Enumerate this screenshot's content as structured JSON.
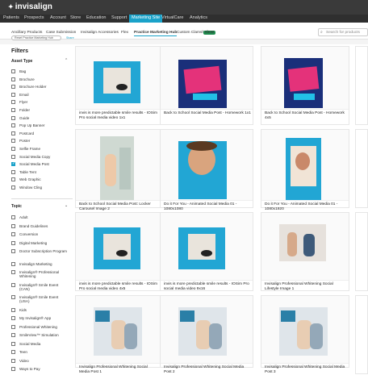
{
  "header": {
    "logo": "invisalign",
    "nav": [
      "Patients",
      "Prospects",
      "Account",
      "Store",
      "Education",
      "Support",
      "Marketing Site",
      "VirtualCare",
      "Analytics"
    ],
    "active_nav": "Marketing Site"
  },
  "subnav": {
    "items": [
      "Ancillary Products",
      "Case Submission",
      "Invisalign Accessories",
      "Flex",
      "Practice Marketing Hub",
      "Custom Clamshell"
    ],
    "selected": "Practice Marketing Hub",
    "badge": "NEW",
    "search_placeholder": "Search for products"
  },
  "breadcrumb": {
    "pill": "Reset Practice Marketing Hub",
    "link": "Share"
  },
  "sidebar": {
    "title": "Filters",
    "asset_type": {
      "title": "Asset Type",
      "options": [
        "Bag",
        "Brochure",
        "Brochure Holder",
        "Email",
        "Flyer",
        "Folder",
        "Guide",
        "Pop Up Banner",
        "Postcard",
        "Poster",
        "Selfie Frame",
        "Social Media Copy",
        "Social Media Post",
        "Table Tent",
        "Web Graphic",
        "Window Cling"
      ],
      "checked": [
        "Social Media Post"
      ]
    },
    "topic": {
      "title": "Topic",
      "options": [
        "Adult",
        "Brand Guidelines",
        "Conversion",
        "Digital Marketing",
        "Doctor Subscription Program",
        "Invisalign Marketing",
        "Invisalign® Professional Whitening",
        "Invisalign® Smile Event (CAN)",
        "Invisalign® Smile Event (USA)",
        "Kids",
        "My Invisalign® App",
        "Professional Whitening",
        "SmileView™ Simulation",
        "Social Media",
        "Teen",
        "Video",
        "Ways to Pay"
      ]
    }
  },
  "products": [
    {
      "caption": "invis is more predictable smile results - IOSim Pro social media video 1x1",
      "thumb": "blue-tile-aligner"
    },
    {
      "caption": "Back to School Social Media Post - Homework 1x1",
      "thumb": "pink-notebook"
    },
    {
      "caption": "Back to School Social Media Post - Homework 4x5",
      "thumb": "pink-notebook-tall"
    },
    {
      "caption": "Back to School Social Media Post: Locker Carousel Image 2",
      "thumb": "locker-photo"
    },
    {
      "caption": "Do it For You - Animated Social Media 01 - 1080x1080",
      "thumb": "teen-boy-smile"
    },
    {
      "caption": "Do it For You - Animated Social Media 01 - 1080x1920",
      "thumb": "teen-girl-mirror"
    },
    {
      "caption": "invis is more predictable smile results - IOSim Pro social media video 4x5",
      "thumb": "blue-tile-aligner"
    },
    {
      "caption": "invis is more predictable smile results - IOSim Pro social media video 9x16",
      "thumb": "blue-tile-aligner-tall"
    },
    {
      "caption": "Invisalign Professional Whitening Social Lifestyle Image 1",
      "thumb": "two-women-sofa"
    },
    {
      "caption": "Invisalign Professional Whitening Social Media Post 1",
      "thumb": "woman-laptop"
    },
    {
      "caption": "Invisalign Professional Whitening Social Media Post 2",
      "thumb": "two-women-laughing"
    },
    {
      "caption": "Invisalign Professional Whitening Social Media Post 3",
      "thumb": "woman-outdoors"
    }
  ],
  "colors": {
    "accent": "#1aa2c9",
    "topbar": "#3a3a3a",
    "tile_blue": "#22a6d4"
  }
}
